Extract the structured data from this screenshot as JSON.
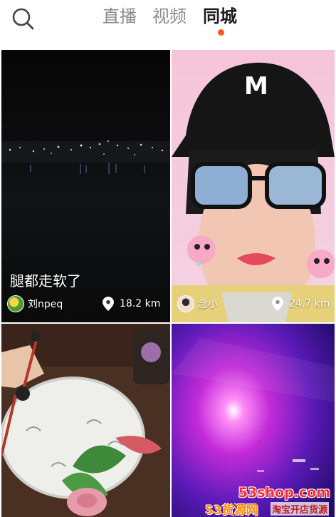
{
  "header": {
    "tabs": [
      {
        "label": "直播"
      },
      {
        "label": "视频"
      },
      {
        "label": "同城"
      }
    ],
    "active_tab": "同城",
    "indicator_color": "#ff5a16"
  },
  "feed": {
    "cards": [
      {
        "caption": "腿都走软了",
        "user": {
          "name": "刘npeq"
        },
        "distance": "18.2 km"
      },
      {
        "caption": "",
        "user": {
          "name": "念小"
        },
        "distance": "24.7 km"
      },
      {
        "caption": "",
        "user": {
          "name": ""
        },
        "distance": ""
      },
      {
        "caption": "",
        "user": {
          "name": ""
        },
        "distance": ""
      }
    ]
  },
  "watermark": {
    "site": "53shop.com",
    "brand": "53货源网",
    "slogan": "淘宝开店货源"
  }
}
